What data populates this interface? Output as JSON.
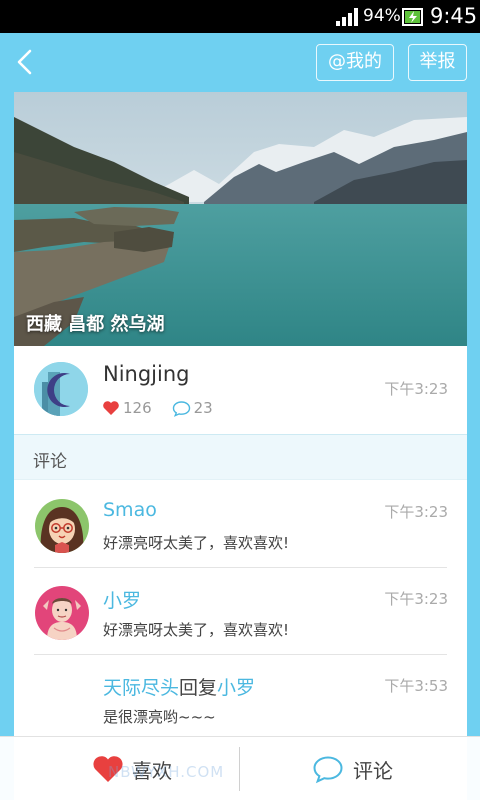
{
  "status_bar": {
    "battery_percent": "94%",
    "time": "9:45"
  },
  "top_bar": {
    "mine_button": "@我的",
    "report_button": "举报"
  },
  "post": {
    "location_caption": "西藏 昌都 然乌湖",
    "author": "Ningjing",
    "likes": "126",
    "comments": "23",
    "time": "下午3:23"
  },
  "comments_section": {
    "title": "评论"
  },
  "comments": [
    {
      "name": "Smao",
      "text": "好漂亮呀太美了，喜欢喜欢!",
      "time": "下午3:23"
    },
    {
      "name": "小罗",
      "text": "好漂亮呀太美了，喜欢喜欢!",
      "time": "下午3:23"
    },
    {
      "name": "天际尽头",
      "reply_word": "回复",
      "reply_to": "小罗",
      "text": "是很漂亮哟~~~",
      "time": "下午3:53"
    }
  ],
  "bottom_bar": {
    "like_label": "喜欢",
    "comment_label": "评论",
    "watermark": "NBWYXH.COM"
  },
  "colors": {
    "accent": "#6fd0f1",
    "name_blue": "#4bb8e0",
    "heart_red": "#e8403f"
  }
}
